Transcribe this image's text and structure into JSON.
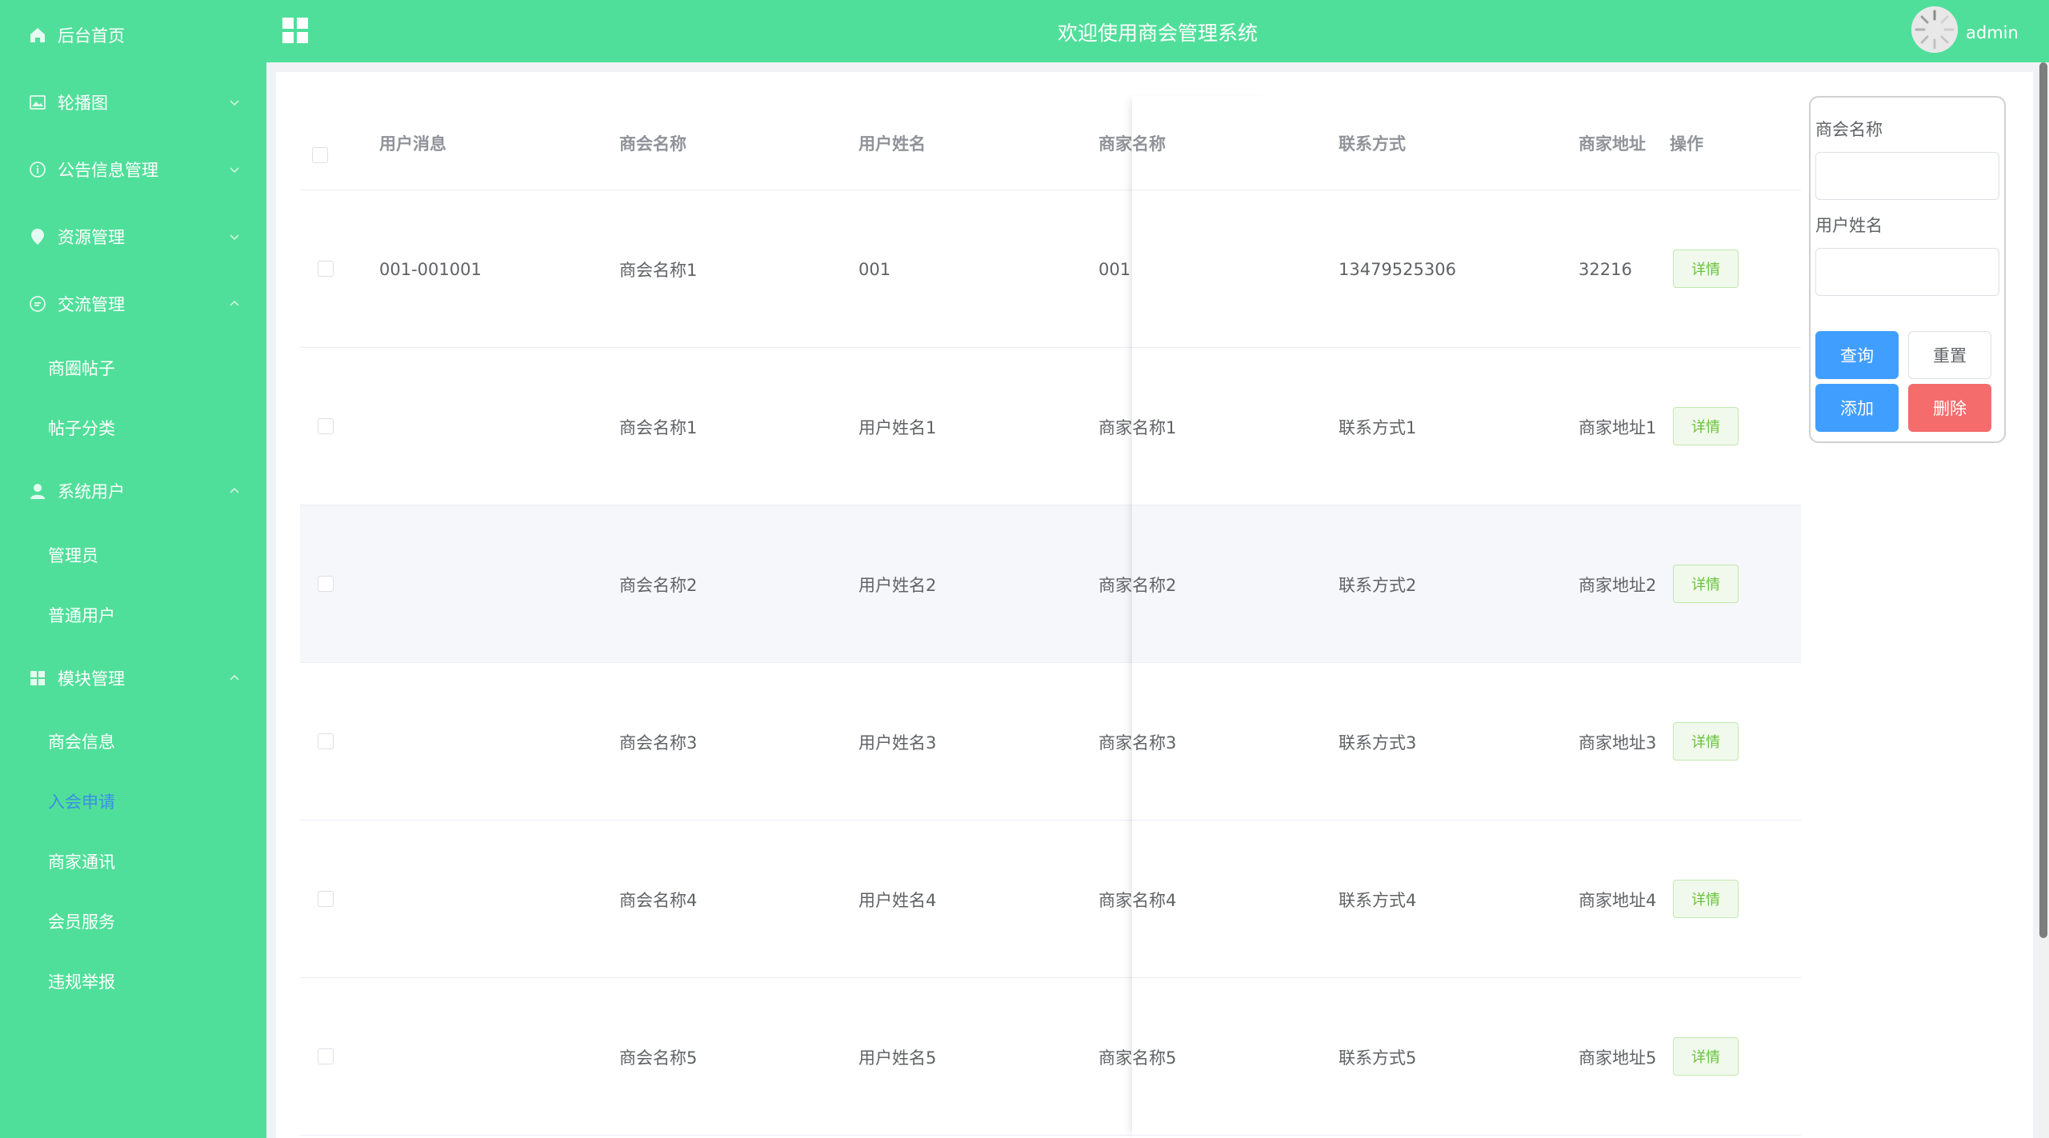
{
  "header": {
    "title": "欢迎使用商会管理系统",
    "username": "admin"
  },
  "sidebar": {
    "items": [
      {
        "label": "后台首页",
        "icon": "home-icon"
      },
      {
        "label": "轮播图",
        "icon": "image-icon"
      },
      {
        "label": "公告信息管理",
        "icon": "info-icon"
      },
      {
        "label": "资源管理",
        "icon": "location-icon"
      },
      {
        "label": "交流管理",
        "icon": "chat-icon"
      },
      {
        "label": "系统用户",
        "icon": "user-icon"
      },
      {
        "label": "模块管理",
        "icon": "grid-icon"
      }
    ],
    "sub_comm": [
      "商圈帖子",
      "帖子分类"
    ],
    "sub_users": [
      "管理员",
      "普通用户"
    ],
    "sub_modules": [
      "商会信息",
      "入会申请",
      "商家通讯",
      "会员服务",
      "违规举报"
    ],
    "active_item": "入会申请",
    "active_color": "#3a8ee6"
  },
  "table": {
    "headers": [
      "用户消息",
      "商会名称",
      "用户姓名",
      "商家名称",
      "联系方式",
      "商家地址",
      "操作"
    ],
    "action_label": "详情",
    "rows": [
      {
        "msg": "001-001001",
        "chamber": "商会名称1",
        "user": "001",
        "merchant": "001",
        "contact": "13479525306",
        "address": "32216"
      },
      {
        "msg": "",
        "chamber": "商会名称1",
        "user": "用户姓名1",
        "merchant": "商家名称1",
        "contact": "联系方式1",
        "address": "商家地址1"
      },
      {
        "msg": "",
        "chamber": "商会名称2",
        "user": "用户姓名2",
        "merchant": "商家名称2",
        "contact": "联系方式2",
        "address": "商家地址2"
      },
      {
        "msg": "",
        "chamber": "商会名称3",
        "user": "用户姓名3",
        "merchant": "商家名称3",
        "contact": "联系方式3",
        "address": "商家地址3"
      },
      {
        "msg": "",
        "chamber": "商会名称4",
        "user": "用户姓名4",
        "merchant": "商家名称4",
        "contact": "联系方式4",
        "address": "商家地址4"
      },
      {
        "msg": "",
        "chamber": "商会名称5",
        "user": "用户姓名5",
        "merchant": "商家名称5",
        "contact": "联系方式5",
        "address": "商家地址5"
      }
    ]
  },
  "search": {
    "label_chamber": "商会名称",
    "label_user": "用户姓名",
    "chamber_value": "",
    "user_value": "",
    "query": "查询",
    "reset": "重置",
    "add": "添加",
    "delete": "删除"
  },
  "colors": {
    "theme_green": "#50df9a",
    "primary": "#409eff",
    "danger": "#f56c6c",
    "success": "#67c23a"
  }
}
